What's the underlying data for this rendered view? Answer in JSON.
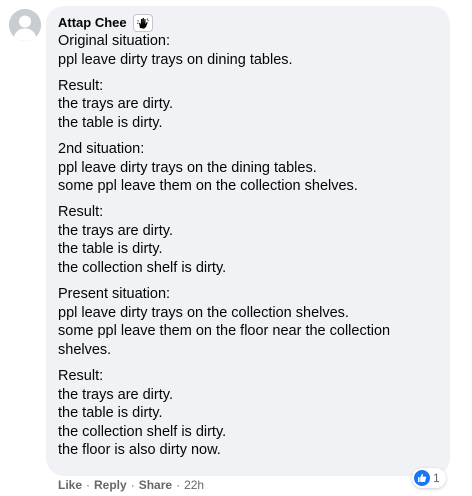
{
  "comment": {
    "author": "Attap Chee",
    "paragraphs": [
      [
        "Original situation:",
        "ppl leave dirty trays on dining tables."
      ],
      [
        "Result:",
        "the trays are dirty.",
        "the table is dirty."
      ],
      [
        "2nd situation:",
        "ppl leave dirty trays on the dining tables.",
        "some ppl leave them on the collection shelves."
      ],
      [
        "Result:",
        "the trays are dirty.",
        "the table is dirty.",
        "the collection shelf is dirty."
      ],
      [
        "Present situation:",
        "ppl leave dirty trays on the collection shelves.",
        "some ppl leave them on the floor near the collection shelves."
      ],
      [
        "Result:",
        "the trays are dirty.",
        "the table is dirty.",
        "the collection shelf is dirty.",
        "the floor is also dirty now."
      ]
    ],
    "reaction_count": "1",
    "actions": {
      "like": "Like",
      "reply": "Reply",
      "share": "Share",
      "time": "22h",
      "separator": "·"
    }
  },
  "colors": {
    "bubble": "#f0f2f5",
    "meta": "#65676b",
    "like_blue": "#1877f2"
  },
  "icons": {
    "badge": "rising-fan-hand-icon",
    "reaction": "thumbs-up-icon"
  }
}
